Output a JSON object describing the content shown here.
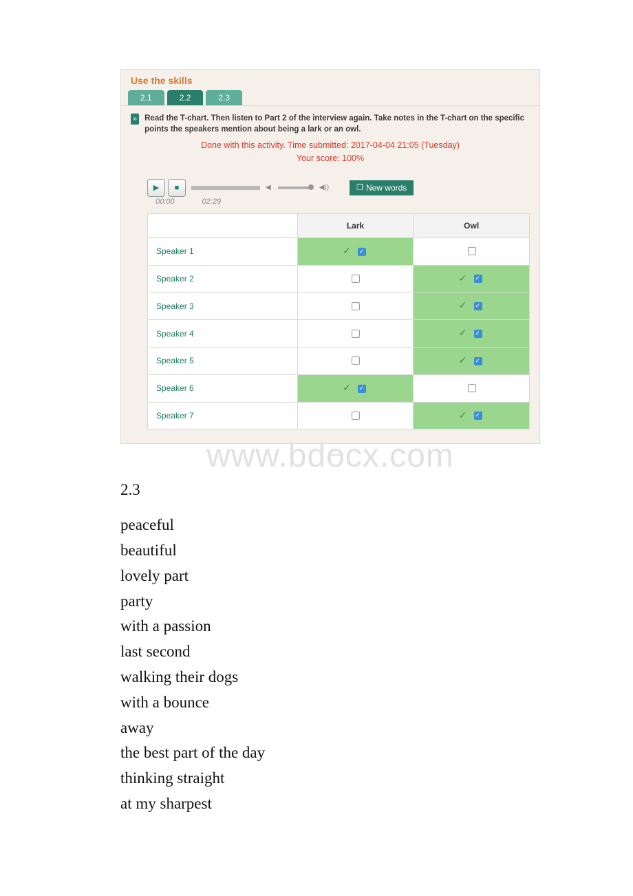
{
  "panel": {
    "title": "Use the skills",
    "tabs": [
      "2.1",
      "2.2",
      "2.3"
    ],
    "active_tab": 1,
    "bullet_glyph": "»",
    "instruction": "Read the T-chart. Then listen to Part 2 of the interview again. Take notes in the T-chart on the specific points the speakers mention about being a lark or an owl.",
    "done_line": "Done with this activity. Time submitted: 2017-04-04 21:05 (Tuesday)",
    "score_line": "Your score: 100%",
    "audio": {
      "play_glyph": "▶",
      "stop_glyph": "■",
      "current": "00:00",
      "total": "02:29",
      "mute_glyph": "◀",
      "vol_glyph": "◀))"
    },
    "new_words_icon": "❐",
    "new_words_label": "New words",
    "columns": {
      "c1": "Lark",
      "c2": "Owl"
    },
    "rows": [
      {
        "label": "Speaker 1",
        "lark": true,
        "owl": false
      },
      {
        "label": "Speaker 2",
        "lark": false,
        "owl": true
      },
      {
        "label": "Speaker 3",
        "lark": false,
        "owl": true
      },
      {
        "label": "Speaker 4",
        "lark": false,
        "owl": true
      },
      {
        "label": "Speaker 5",
        "lark": false,
        "owl": true
      },
      {
        "label": "Speaker 6",
        "lark": true,
        "owl": false
      },
      {
        "label": "Speaker 7",
        "lark": false,
        "owl": true
      }
    ]
  },
  "watermark": "www.bdocx.com",
  "below": {
    "section": "2.3",
    "lines": [
      "peaceful",
      "beautiful",
      "lovely part",
      "party",
      "with a passion",
      "last second",
      "walking their dogs",
      "with a bounce",
      "away",
      "the best part of the day",
      "thinking straight",
      "at my sharpest"
    ]
  }
}
